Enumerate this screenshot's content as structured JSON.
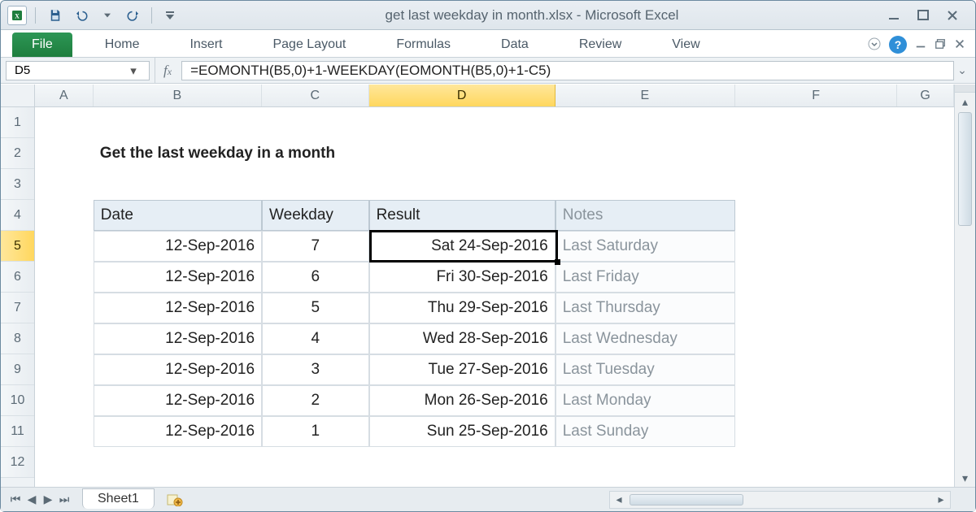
{
  "app": {
    "title": "get last weekday in month.xlsx  -  Microsoft Excel"
  },
  "ribbon": {
    "file": "File",
    "tabs": [
      "Home",
      "Insert",
      "Page Layout",
      "Formulas",
      "Data",
      "Review",
      "View"
    ]
  },
  "namebox": "D5",
  "formula": "=EOMONTH(B5,0)+1-WEEKDAY(EOMONTH(B5,0)+1-C5)",
  "columns": [
    "A",
    "B",
    "C",
    "D",
    "E",
    "F",
    "G"
  ],
  "rows": [
    "1",
    "2",
    "3",
    "4",
    "5",
    "6",
    "7",
    "8",
    "9",
    "10",
    "11",
    "12"
  ],
  "selected": {
    "col": "D",
    "row": "5"
  },
  "title_cell": "Get the last weekday in a month",
  "headers": {
    "date": "Date",
    "weekday": "Weekday",
    "result": "Result",
    "notes": "Notes"
  },
  "data_rows": [
    {
      "date": "12-Sep-2016",
      "weekday": "7",
      "result": "Sat 24-Sep-2016",
      "notes": "Last Saturday"
    },
    {
      "date": "12-Sep-2016",
      "weekday": "6",
      "result": "Fri 30-Sep-2016",
      "notes": "Last Friday"
    },
    {
      "date": "12-Sep-2016",
      "weekday": "5",
      "result": "Thu 29-Sep-2016",
      "notes": "Last Thursday"
    },
    {
      "date": "12-Sep-2016",
      "weekday": "4",
      "result": "Wed 28-Sep-2016",
      "notes": "Last Wednesday"
    },
    {
      "date": "12-Sep-2016",
      "weekday": "3",
      "result": "Tue 27-Sep-2016",
      "notes": "Last Tuesday"
    },
    {
      "date": "12-Sep-2016",
      "weekday": "2",
      "result": "Mon 26-Sep-2016",
      "notes": "Last Monday"
    },
    {
      "date": "12-Sep-2016",
      "weekday": "1",
      "result": "Sun 25-Sep-2016",
      "notes": "Last Sunday"
    }
  ],
  "sheet": {
    "name": "Sheet1"
  }
}
